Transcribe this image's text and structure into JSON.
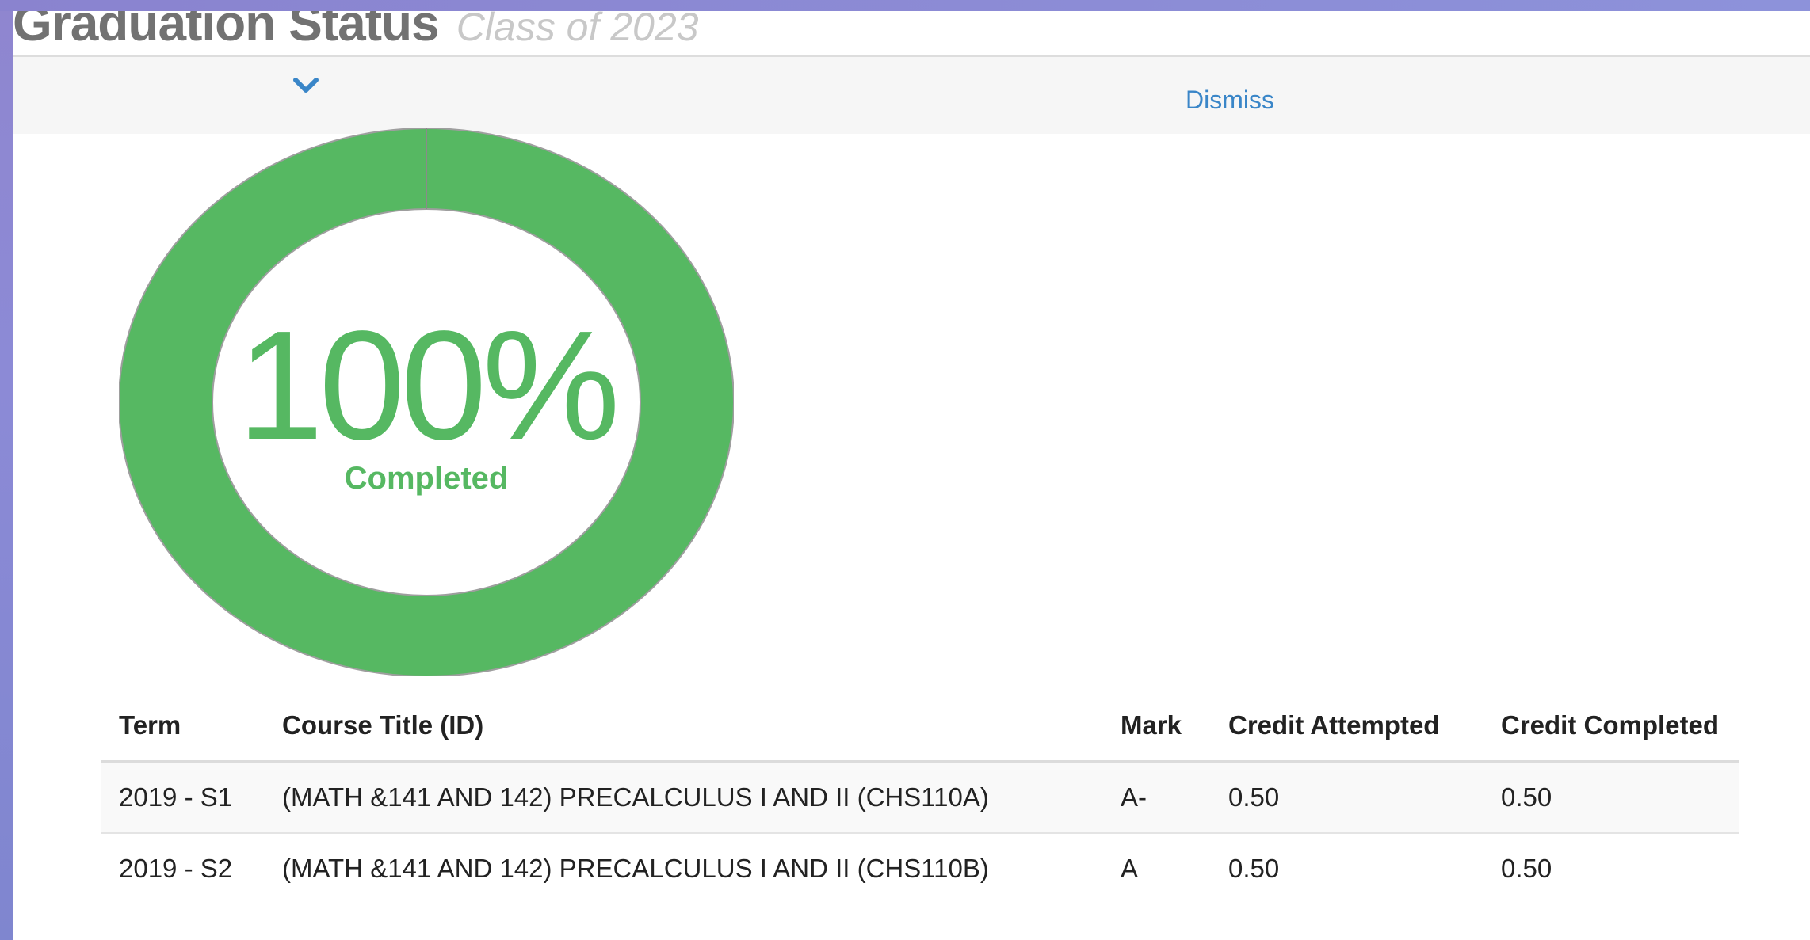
{
  "header": {
    "title": "Graduation Status",
    "subtitle": "Class of 2023"
  },
  "toolbar": {
    "expand_icon": "chevron-down-icon",
    "dismiss_label": "Dismiss"
  },
  "progress": {
    "percent_label": "100%",
    "percent_value": 100,
    "status_label": "Completed",
    "color": "#56b862"
  },
  "table": {
    "headers": {
      "term": "Term",
      "course": "Course Title (ID)",
      "mark": "Mark",
      "credit_attempted": "Credit Attempted",
      "credit_completed": "Credit Completed"
    },
    "rows": [
      {
        "term": "2019 - S1",
        "course": "(MATH &141 AND 142) PRECALCULUS I AND II (CHS110A)",
        "mark": "A-",
        "credit_attempted": "0.50",
        "credit_completed": "0.50"
      },
      {
        "term": "2019 - S2",
        "course": "(MATH &141 AND 142) PRECALCULUS I AND II (CHS110B)",
        "mark": "A",
        "credit_attempted": "0.50",
        "credit_completed": "0.50"
      }
    ]
  },
  "colors": {
    "accent_green": "#56b862",
    "link_blue": "#3a86c8"
  }
}
